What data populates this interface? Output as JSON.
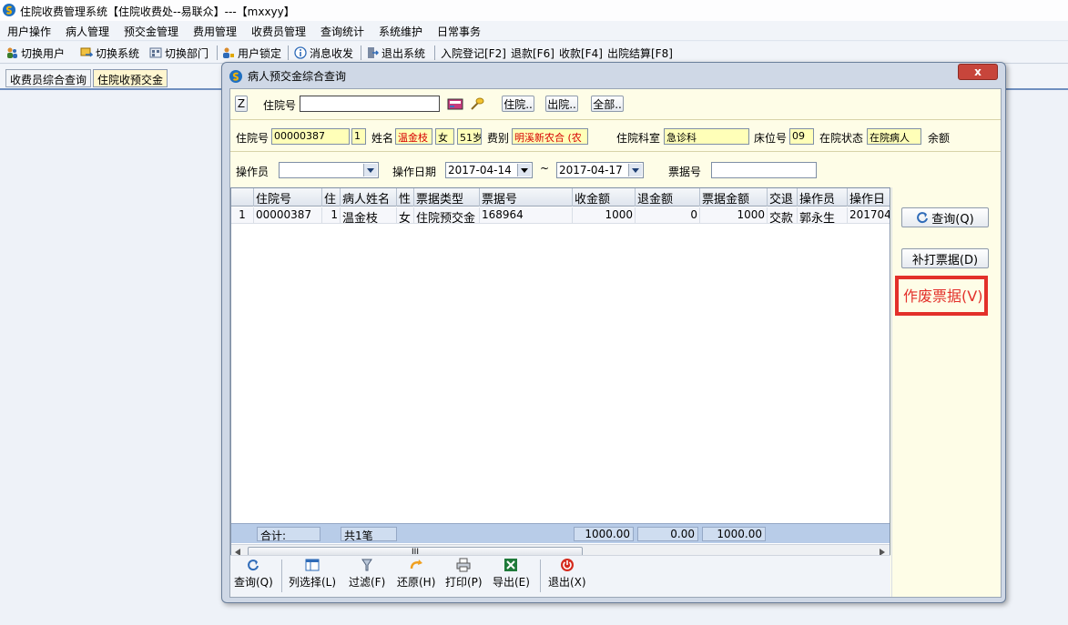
{
  "app": {
    "title": "住院收费管理系统【住院收费处--易联众】---【mxxyy】"
  },
  "menu": [
    "用户操作",
    "病人管理",
    "预交金管理",
    "费用管理",
    "收费员管理",
    "查询统计",
    "系统维护",
    "日常事务"
  ],
  "toolbar": {
    "switch_user": "切换用户",
    "switch_system": "切换系统",
    "switch_dept": "切换部门",
    "lock_user": "用户锁定",
    "messages": "消息收发",
    "exit_system": "退出系统",
    "admission": "入院登记[F2]",
    "refund": "退款[F6]",
    "charge": "收款[F4]",
    "discharge": "出院结算[F8]"
  },
  "tabs": [
    "收费员综合查询",
    "住院收预交金"
  ],
  "dialog": {
    "title": "病人预交金综合查询",
    "close": "x",
    "z_label": "Z",
    "search": {
      "inpatient_no_label": "住院号",
      "inpatient_no_value": "",
      "btn_in": "住院..",
      "btn_out": "出院..",
      "btn_all": "全部.."
    },
    "patient": {
      "no_label": "住院号",
      "no": "00000387",
      "times": "1",
      "name_label": "姓名",
      "name": "温金枝",
      "sex": "女",
      "age": "51岁",
      "fee_label": "费别",
      "fee": "明溪新农合 (农",
      "dept_label": "住院科室",
      "dept": "急诊科",
      "bed_label": "床位号",
      "bed": "09",
      "status_label": "在院状态",
      "status": "在院病人",
      "balance_label": "余额"
    },
    "filter": {
      "operator_label": "操作员",
      "operator_value": "",
      "date_label": "操作日期",
      "date_from": "2017-04-14",
      "tilde": "~",
      "date_to": "2017-04-17",
      "receipt_label": "票据号",
      "receipt_value": ""
    },
    "grid": {
      "headers": [
        "住院号",
        "住",
        "病人姓名",
        "性",
        "票据类型",
        "票据号",
        "收金额",
        "退金额",
        "票据金额",
        "交退",
        "操作员",
        "操作日"
      ],
      "rows": [
        [
          "1",
          "00000387",
          "1",
          "温金枝",
          "女",
          "住院预交金",
          "168964",
          "1000",
          "0",
          "1000",
          "交款",
          "郭永生",
          "201704:"
        ]
      ],
      "footer": {
        "total_label": "合计:",
        "count": "共1笔",
        "sum_in": "1000.00",
        "sum_out": "0.00",
        "sum_receipt": "1000.00"
      },
      "scroll_thumb": "III"
    },
    "side": {
      "query": "查询(Q)",
      "reprint": "补打票据(D)",
      "void": "作废票据(V)"
    },
    "bottom": {
      "query": "查询(Q)",
      "columns": "列选择(L)",
      "filter": "过滤(F)",
      "restore": "还原(H)",
      "print": "打印(P)",
      "export": "导出(E)",
      "exit": "退出(X)"
    }
  },
  "colors": {
    "accent_red": "#e3302a",
    "highlight_yellow": "#ffffb8",
    "dialog_bg": "#fefde7"
  }
}
